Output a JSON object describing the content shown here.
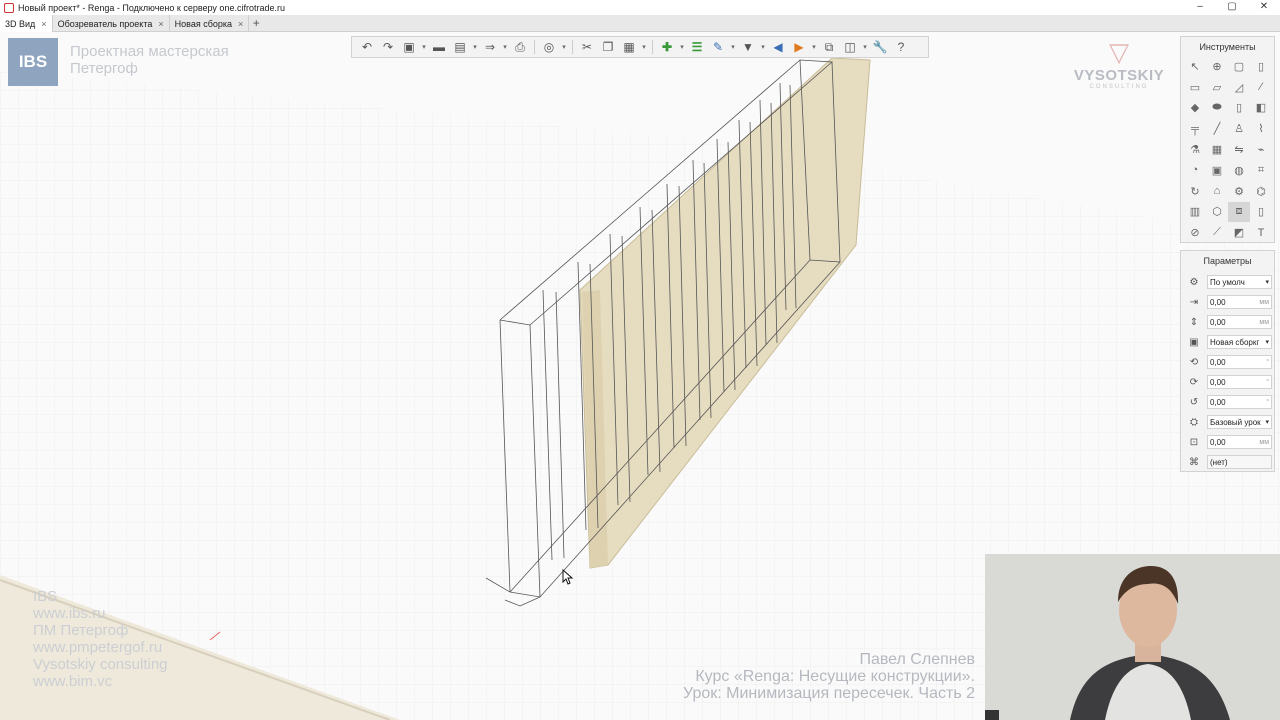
{
  "window": {
    "title": "Новый проект* - Renga - Подключено к серверу one.cifrotrade.ru",
    "minimize": "–",
    "maximize": "▢",
    "close": "✕"
  },
  "tabs": [
    {
      "label": "3D Вид",
      "close": "×"
    },
    {
      "label": "Обозреватель проекта",
      "close": "×"
    },
    {
      "label": "Новая сборка",
      "close": "×"
    }
  ],
  "tab_add": "+",
  "overlay": {
    "ibs_logo": "IBS",
    "studio_line1": "Проектная мастерская",
    "studio_line2": "Петергоф",
    "vysotskiy_name": "VYSOTSKIY",
    "vysotskiy_sub": "CONSULTING",
    "watermark": [
      "IBS",
      "www.ibs.ru",
      "ПМ Петергоф",
      "www.pmpetergof.ru",
      "Vysotskiy consulting",
      "www.bim.vc"
    ],
    "credit_name": "Павел Слепнев",
    "credit_course": "Курс «Renga: Несущие конструкции».",
    "credit_lesson": "Урок: Минимизация пересечек. Часть 2"
  },
  "toolbar": {
    "icons": [
      "undo-icon",
      "redo-icon",
      "view-cube-icon",
      "folder-icon",
      "save-icon",
      "export-icon",
      "print-icon",
      "orbit-icon",
      "cut-icon",
      "copy-icon",
      "paste-icon",
      "add-icon",
      "list-icon",
      "paint-icon",
      "filter-icon",
      "import-icon",
      "export-arrow-icon",
      "layers-icon",
      "visibility-icon",
      "wrench-icon",
      "help-icon"
    ]
  },
  "tools_panel": {
    "title": "Инструменты",
    "selected_index": 30
  },
  "params_panel": {
    "title": "Параметры",
    "rows": [
      {
        "icon": "style-icon",
        "value": "По умолч",
        "unit": "",
        "dropdown": true
      },
      {
        "icon": "offset-icon",
        "value": "0,00",
        "unit": "мм",
        "dropdown": false
      },
      {
        "icon": "height-icon",
        "value": "0,00",
        "unit": "мм",
        "dropdown": false
      },
      {
        "icon": "assembly-icon",
        "value": "Новая сборкг",
        "unit": "",
        "dropdown": true
      },
      {
        "icon": "rotate-x-icon",
        "value": "0,00",
        "unit": "°",
        "dropdown": false
      },
      {
        "icon": "rotate-y-icon",
        "value": "0,00",
        "unit": "°",
        "dropdown": false
      },
      {
        "icon": "rotate-z-icon",
        "value": "0,00",
        "unit": "°",
        "dropdown": false
      },
      {
        "icon": "level-icon",
        "value": "Базовый урок",
        "unit": "",
        "dropdown": true
      },
      {
        "icon": "elevation-icon",
        "value": "0,00",
        "unit": "мм",
        "dropdown": false
      },
      {
        "icon": "mark-icon",
        "value": "(нет)",
        "unit": "",
        "dropdown": false
      }
    ]
  }
}
